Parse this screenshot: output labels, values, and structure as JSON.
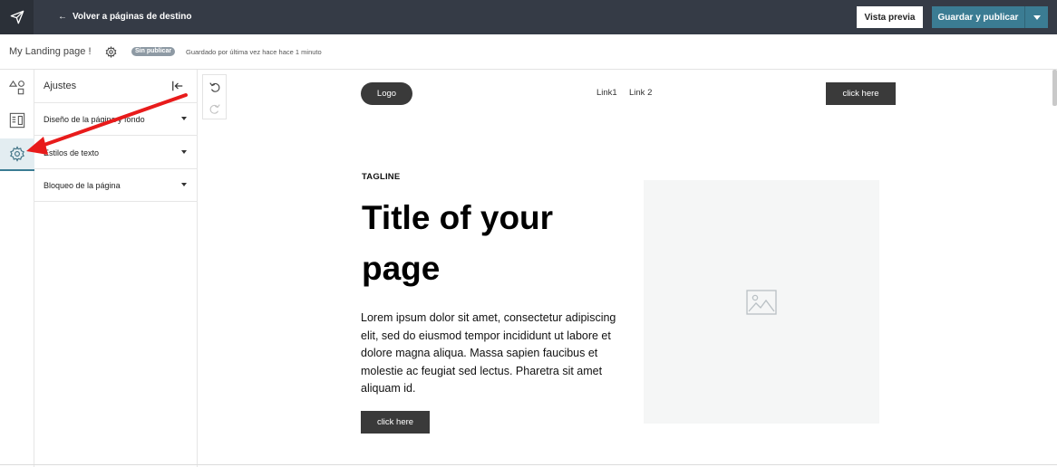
{
  "topbar": {
    "back_label": "Volver a páginas de destino",
    "preview_label": "Vista previa",
    "publish_label": "Guardar y publicar",
    "brand_color": "#353b46",
    "accent_color": "#3b7c93"
  },
  "subbar": {
    "page_name": "My Landing page !",
    "status_badge": "Sin publicar",
    "saved_text": "Guardado por última vez hace hace 1 minuto"
  },
  "rail": {
    "items": [
      {
        "name": "elements-icon"
      },
      {
        "name": "layout-icon"
      },
      {
        "name": "settings-icon",
        "active": true
      }
    ]
  },
  "panel": {
    "title": "Ajustes",
    "rows": [
      {
        "label": "Diseño de la página y fondo"
      },
      {
        "label": "Estilos de texto"
      },
      {
        "label": "Bloqueo de la página"
      }
    ]
  },
  "landing": {
    "logo": "Logo",
    "links": [
      "Link1",
      "Link 2"
    ],
    "nav_button": "click here",
    "tagline": "TAGLINE",
    "title": "Title of your page",
    "body": "Lorem ipsum dolor sit amet, consectetur adipiscing elit, sed do eiusmod tempor incididunt ut labore et dolore magna aliqua. Massa sapien faucibus et molestie ac feugiat sed lectus. Pharetra sit amet aliquam id.",
    "cta_button": "click here"
  }
}
